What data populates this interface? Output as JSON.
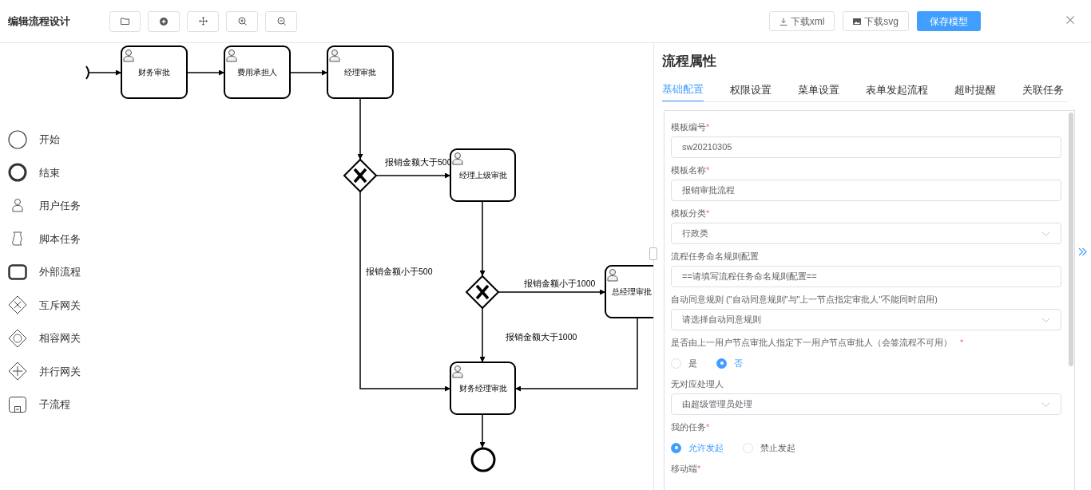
{
  "header": {
    "title": "编辑流程设计",
    "actions": [
      {
        "kind": "download",
        "label": "下载xml"
      },
      {
        "kind": "image",
        "label": "下载svg"
      },
      {
        "kind": "primary",
        "label": "保存模型"
      }
    ]
  },
  "palette": [
    {
      "kind": "start",
      "label": "开始"
    },
    {
      "kind": "end",
      "label": "结束"
    },
    {
      "kind": "user",
      "label": "用户任务"
    },
    {
      "kind": "script",
      "label": "脚本任务"
    },
    {
      "kind": "call",
      "label": "外部流程"
    },
    {
      "kind": "xor",
      "label": "互斥网关"
    },
    {
      "kind": "or",
      "label": "相容网关"
    },
    {
      "kind": "and",
      "label": "并行网关"
    },
    {
      "kind": "sub",
      "label": "子流程"
    }
  ],
  "diagram": {
    "tasks": [
      {
        "label": "财务审批"
      },
      {
        "label": "费用承担人"
      },
      {
        "label": "经理审批"
      },
      {
        "label": "经理上级审批"
      },
      {
        "label": "总经理审批"
      },
      {
        "label": "财务经理审批"
      }
    ],
    "flow_labels": [
      "报销金额大于500",
      "报销金额小于500",
      "报销金额小于1000",
      "报销金额大于1000"
    ]
  },
  "panel": {
    "title": "流程属性",
    "tabs": [
      {
        "label": "基础配置",
        "selected": true
      },
      {
        "label": "权限设置",
        "selected": false
      },
      {
        "label": "菜单设置",
        "selected": false
      },
      {
        "label": "表单发起流程",
        "selected": false
      },
      {
        "label": "超时提醒",
        "selected": false
      },
      {
        "label": "关联任务",
        "selected": false
      }
    ],
    "fields": [
      {
        "label": "模板编号",
        "required_mark": "*",
        "kind": "input",
        "value": "sw20210305"
      },
      {
        "label": "模板名称",
        "required_mark": "*",
        "kind": "input",
        "value": "报销审批流程"
      },
      {
        "label": "模板分类",
        "required_mark": "*",
        "kind": "select",
        "value": "行政类"
      },
      {
        "label": "流程任务命名规则配置",
        "kind": "input",
        "value": "==请填写流程任务命名规则配置=="
      },
      {
        "label": "自动同意规则 (\"自动同意规则\"与\"上一节点指定审批人\"不能同时启用)",
        "kind": "select",
        "value": "请选择自动同意规则"
      },
      {
        "label": "是否由上一用户节点审批人指定下一用户节点审批人（会签流程不可用）",
        "required_mark": "*",
        "kind": "radio",
        "options": [
          {
            "label": "是",
            "selected": false
          },
          {
            "label": "否",
            "selected": true
          }
        ]
      },
      {
        "label": "无对应处理人",
        "kind": "select",
        "value": "由超级管理员处理"
      },
      {
        "label": "我的任务",
        "required_mark": "*",
        "kind": "radio",
        "options": [
          {
            "label": "允许发起",
            "selected": true
          },
          {
            "label": "禁止发起",
            "selected": false
          }
        ]
      },
      {
        "label": "移动端",
        "required_mark": "*",
        "kind": "label"
      }
    ]
  }
}
